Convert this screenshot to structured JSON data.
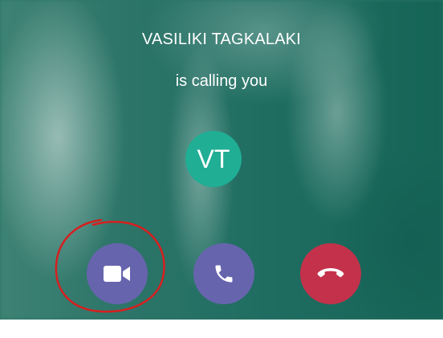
{
  "incoming_call": {
    "caller_name": "VASILIKI TAGKALAKI",
    "status": "is calling you",
    "avatar_initials": "VT"
  },
  "actions": {
    "video": {
      "icon": "video-camera-icon"
    },
    "audio": {
      "icon": "phone-icon"
    },
    "decline": {
      "icon": "hang-up-icon"
    }
  },
  "colors": {
    "background": "#2c7468",
    "avatar": "#20ae95",
    "accept_button": "#6764ae",
    "decline_button": "#c4314b",
    "annotation": "#d61f1f"
  }
}
